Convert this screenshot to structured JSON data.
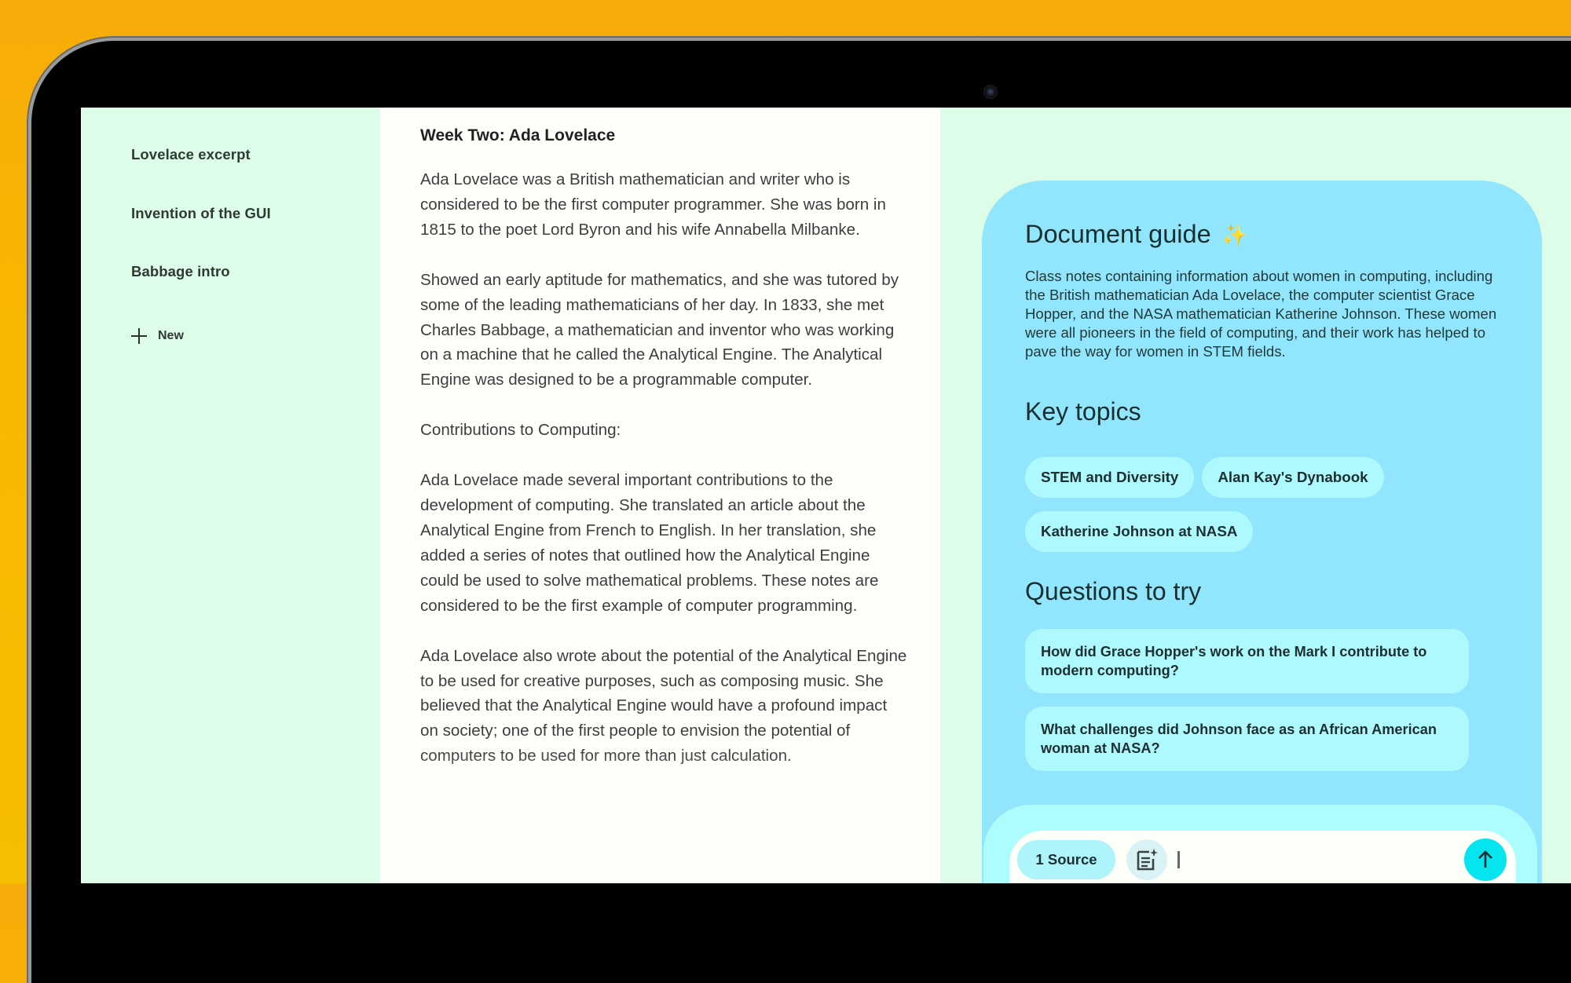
{
  "sidebar": {
    "items": [
      {
        "label": "Lovelace excerpt"
      },
      {
        "label": "Invention of the GUI"
      },
      {
        "label": "Babbage intro"
      }
    ],
    "new_label": "New",
    "new_icon": "plus-icon"
  },
  "document": {
    "title": "Week Two: Ada Lovelace",
    "paragraphs": [
      "Ada Lovelace was a British mathematician and writer who is considered to be the first computer programmer. She was born in 1815 to the poet Lord Byron and his wife Annabella Milbanke.",
      "Showed an early aptitude for mathematics, and she was tutored by some of the leading mathematicians of her day. In 1833, she met Charles Babbage, a mathematician and inventor who was working on a machine that he called the Analytical Engine. The Analytical Engine was designed to be a programmable computer.",
      "Contributions to Computing:",
      "Ada Lovelace made several important contributions to the development of computing. She translated an article about the Analytical Engine from French to English. In her translation, she added a series of notes that outlined how the Analytical Engine could be used to solve mathematical problems. These notes are considered to be the first example of computer programming.",
      "Ada Lovelace also wrote about the potential of the Analytical Engine to be used for creative purposes, such as composing music. She believed that the Analytical Engine would have a profound impact on society; one of the first people to envision the potential of computers to be used for more than just calculation."
    ]
  },
  "guide": {
    "title": "Document guide",
    "title_icon": "sparkle-icon",
    "summary": "Class notes containing information about women in computing, including the British mathematician Ada Lovelace, the computer scientist Grace Hopper, and the NASA mathematician Katherine Johnson. These women were all pioneers in the field of computing, and their work has helped to pave the way for women in STEM fields.",
    "key_topics_heading": "Key topics",
    "key_topics": [
      "STEM and Diversity",
      "Alan Kay's Dynabook",
      "Katherine Johnson at NASA"
    ],
    "questions_heading": "Questions to try",
    "questions": [
      "How did Grace Hopper's work on the Mark I contribute to modern computing?",
      "What challenges did Johnson face as an African American woman at NASA?"
    ]
  },
  "composer": {
    "source_chip": "1 Source",
    "add_note_icon": "note-add-icon",
    "input_value": "",
    "send_icon": "arrow-up-icon"
  },
  "colors": {
    "background_orange": "#f8b800",
    "screen_mint": "#ddfde8",
    "document_bg": "#fefffb",
    "guide_blue": "#91e6fd",
    "chip_cyan": "#adf9fe",
    "send_accent": "#06e4ef",
    "sparkle": "#f5cf3b"
  }
}
